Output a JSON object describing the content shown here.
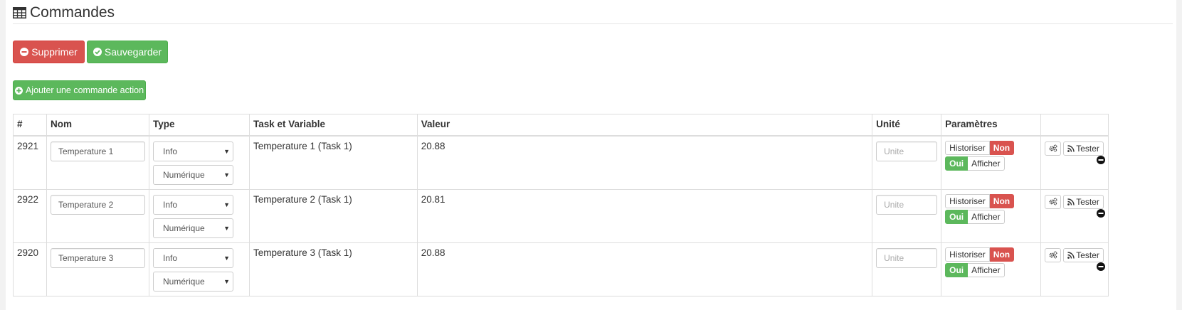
{
  "legend": {
    "title": "Commandes",
    "icon": "table-icon"
  },
  "buttons": {
    "delete": "Supprimer",
    "save": "Sauvegarder",
    "add": "Ajouter une commande action"
  },
  "table": {
    "headers": {
      "id": "#",
      "nom": "Nom",
      "type": "Type",
      "task": "Task et Variable",
      "valeur": "Valeur",
      "unite": "Unité",
      "params": "Paramètres"
    },
    "rows": [
      {
        "id": "2921",
        "nom": "Temperature 1",
        "type": "Info",
        "subtype": "Numérique",
        "task": "Temperature 1 (Task 1)",
        "valeur": "20.88",
        "unit_placeholder": "Unite",
        "historiser": "Historiser",
        "non": "Non",
        "oui": "Oui",
        "afficher": "Afficher",
        "tester": "Tester"
      },
      {
        "id": "2922",
        "nom": "Temperature 2",
        "type": "Info",
        "subtype": "Numérique",
        "task": "Temperature 2 (Task 1)",
        "valeur": "20.81",
        "unit_placeholder": "Unite",
        "historiser": "Historiser",
        "non": "Non",
        "oui": "Oui",
        "afficher": "Afficher",
        "tester": "Tester"
      },
      {
        "id": "2920",
        "nom": "Temperature 3",
        "type": "Info",
        "subtype": "Numérique",
        "task": "Temperature 3 (Task 1)",
        "valeur": "20.88",
        "unit_placeholder": "Unite",
        "historiser": "Historiser",
        "non": "Non",
        "oui": "Oui",
        "afficher": "Afficher",
        "tester": "Tester"
      }
    ]
  },
  "colors": {
    "danger": "#d9534f",
    "success": "#5cb85c"
  }
}
